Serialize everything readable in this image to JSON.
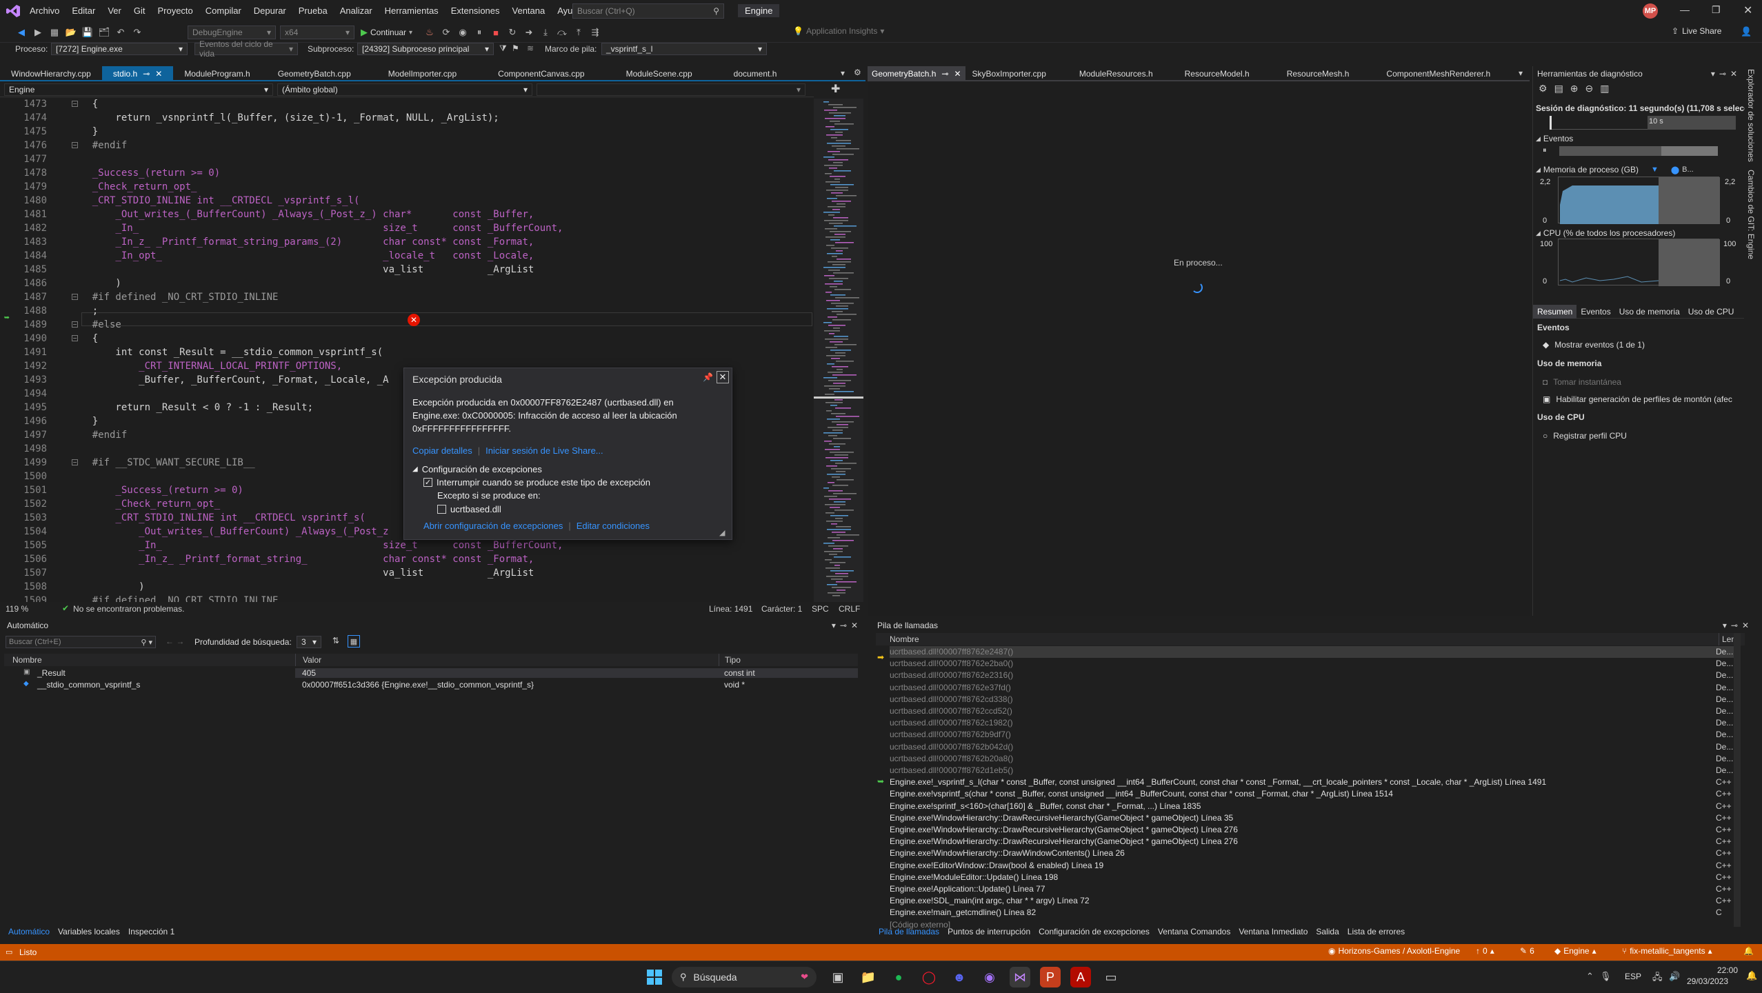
{
  "menubar": {
    "items": [
      "Archivo",
      "Editar",
      "Ver",
      "Git",
      "Proyecto",
      "Compilar",
      "Depurar",
      "Prueba",
      "Analizar",
      "Herramientas",
      "Extensiones",
      "Ventana",
      "Ayuda"
    ],
    "search_placeholder": "Buscar (Ctrl+Q)",
    "solution_name": "Engine",
    "user_initials": "MP"
  },
  "toolbar": {
    "config": "DebugEngine",
    "platform": "x64",
    "continue_label": "Continuar",
    "app_insights": "Application Insights",
    "live_share": "Live Share"
  },
  "toolbar2": {
    "process_label": "Proceso:",
    "process_value": "[7272] Engine.exe",
    "lifecycle_label": "Eventos del ciclo de vida",
    "thread_label": "Subproceso:",
    "thread_value": "[24392] Subproceso principal",
    "stack_frame_label": "Marco de pila:",
    "stack_frame_value": "_vsprintf_s_l"
  },
  "left_tabs": [
    "WindowHierarchy.cpp",
    "stdio.h",
    "ModuleProgram.h",
    "GeometryBatch.cpp",
    "ModelImporter.cpp",
    "ComponentCanvas.cpp",
    "ModuleScene.cpp",
    "document.h"
  ],
  "right_tabs": [
    "GeometryBatch.h",
    "SkyBoxImporter.cpp",
    "ModuleResources.h",
    "ResourceModel.h",
    "ResourceMesh.h",
    "ComponentMeshRenderer.h"
  ],
  "nav": {
    "project": "Engine",
    "scope": "(Ámbito global)"
  },
  "editor_status": {
    "zoom": "119 %",
    "issues": "No se encontraron problemas.",
    "line": "Línea: 1491",
    "char": "Carácter: 1",
    "spc": "SPC",
    "eol": "CRLF"
  },
  "code_lines": [
    {
      "n": "1473",
      "t": "    {"
    },
    {
      "n": "1474",
      "t": "        return _vsnprintf_l(_Buffer, (size_t)-1, _Format, NULL, _ArgList);"
    },
    {
      "n": "1475",
      "t": "    }"
    },
    {
      "n": "1476",
      "t": "    #endif"
    },
    {
      "n": "1477",
      "t": ""
    },
    {
      "n": "1478",
      "t": "    _Success_(return >= 0)"
    },
    {
      "n": "1479",
      "t": "    _Check_return_opt_"
    },
    {
      "n": "1480",
      "t": "    _CRT_STDIO_INLINE int __CRTDECL _vsprintf_s_l("
    },
    {
      "n": "1481",
      "t": "        _Out_writes_(_BufferCount) _Always_(_Post_z_) char*       const _Buffer,"
    },
    {
      "n": "1482",
      "t": "        _In_                                          size_t      const _BufferCount,"
    },
    {
      "n": "1483",
      "t": "        _In_z_ _Printf_format_string_params_(2)       char const* const _Format,"
    },
    {
      "n": "1484",
      "t": "        _In_opt_                                      _locale_t   const _Locale,"
    },
    {
      "n": "1485",
      "t": "                                                      va_list           _ArgList"
    },
    {
      "n": "1486",
      "t": "        )"
    },
    {
      "n": "1487",
      "t": "    #if defined _NO_CRT_STDIO_INLINE"
    },
    {
      "n": "1488",
      "t": "    ;"
    },
    {
      "n": "1489",
      "t": "    #else"
    },
    {
      "n": "1490",
      "t": "    {"
    },
    {
      "n": "1491",
      "t": "        int const _Result = __stdio_common_vsprintf_s("
    },
    {
      "n": "1492",
      "t": "            _CRT_INTERNAL_LOCAL_PRINTF_OPTIONS,"
    },
    {
      "n": "1493",
      "t": "            _Buffer, _BufferCount, _Format, _Locale, _A"
    },
    {
      "n": "1494",
      "t": ""
    },
    {
      "n": "1495",
      "t": "        return _Result < 0 ? -1 : _Result;"
    },
    {
      "n": "1496",
      "t": "    }"
    },
    {
      "n": "1497",
      "t": "    #endif"
    },
    {
      "n": "1498",
      "t": ""
    },
    {
      "n": "1499",
      "t": "    #if __STDC_WANT_SECURE_LIB__"
    },
    {
      "n": "1500",
      "t": ""
    },
    {
      "n": "1501",
      "t": "        _Success_(return >= 0)"
    },
    {
      "n": "1502",
      "t": "        _Check_return_opt_"
    },
    {
      "n": "1503",
      "t": "        _CRT_STDIO_INLINE int __CRTDECL vsprintf_s("
    },
    {
      "n": "1504",
      "t": "            _Out_writes_(_BufferCount) _Always_(_Post_z"
    },
    {
      "n": "1505",
      "t": "            _In_                                      size_t      const _BufferCount,"
    },
    {
      "n": "1506",
      "t": "            _In_z_ _Printf_format_string_             char const* const _Format,"
    },
    {
      "n": "1507",
      "t": "                                                      va_list           _ArgList"
    },
    {
      "n": "1508",
      "t": "            )"
    },
    {
      "n": "1509",
      "t": "    #if defined _NO_CRT_STDIO_INLINE"
    }
  ],
  "exception_popup": {
    "title": "Excepción producida",
    "message": "Excepción producida en 0x00007FF8762E2487 (ucrtbased.dll) en Engine.exe: 0xC0000005: Infracción de acceso al leer la ubicación 0xFFFFFFFFFFFFFFFF.",
    "copy_details": "Copiar detalles",
    "live_share": "Iniciar sesión de Live Share...",
    "config_header": "Configuración de excepciones",
    "break_label": "Interrumpir cuando se produce este tipo de excepción",
    "except_label": "Excepto si se produce en:",
    "dll_label": "ucrtbased.dll",
    "open_config": "Abrir configuración de excepciones",
    "edit_conditions": "Editar condiciones"
  },
  "doc_right": {
    "loading": "En proceso..."
  },
  "diagnostics": {
    "title": "Herramientas de diagnóstico",
    "session": "Sesión de diagnóstico: 11 segundo(s) (11,708 s selecc...",
    "timeline_label": "10 s",
    "events_header": "Eventos",
    "memory_header": "Memoria de proceso (GB)",
    "memory_legend": "B...",
    "mem_max": "2,2",
    "mem_min": "0",
    "cpu_header": "CPU (% de todos los procesadores)",
    "cpu_max": "100",
    "cpu_min": "0",
    "tabs": [
      "Resumen",
      "Eventos",
      "Uso de memoria",
      "Uso de CPU"
    ],
    "sec_events": "Eventos",
    "show_events": "Mostrar eventos (1 de 1)",
    "sec_memory": "Uso de memoria",
    "snapshot": "Tomar instantánea",
    "heap_profiling": "Habilitar generación de perfiles de montón (afec",
    "sec_cpu": "Uso de CPU",
    "record_cpu": "Registrar perfil CPU",
    "side_labels": [
      "Explorador de soluciones",
      "Cambios de GIT: Engine"
    ]
  },
  "autos": {
    "title": "Automático",
    "search_placeholder": "Buscar (Ctrl+E)",
    "depth_label": "Profundidad de búsqueda:",
    "depth_value": "3",
    "columns": [
      "Nombre",
      "Valor",
      "Tipo"
    ],
    "rows": [
      {
        "name": "_Result",
        "value": "405",
        "type": "const int"
      },
      {
        "name": "__stdio_common_vsprintf_s",
        "value": "0x00007ff651c3d366 {Engine.exe!__stdio_common_vsprintf_s}",
        "type": "void *"
      }
    ],
    "bottom_tabs": [
      "Automático",
      "Variables locales",
      "Inspección 1"
    ]
  },
  "callstack": {
    "title": "Pila de llamadas",
    "columns": [
      "Nombre",
      "Leng"
    ],
    "rows": [
      {
        "name": "ucrtbased.dll!00007ff8762e2487()",
        "lang": "De..."
      },
      {
        "name": "ucrtbased.dll!00007ff8762e2ba0()",
        "lang": "De..."
      },
      {
        "name": "ucrtbased.dll!00007ff8762e2316()",
        "lang": "De..."
      },
      {
        "name": "ucrtbased.dll!00007ff8762e37fd()",
        "lang": "De..."
      },
      {
        "name": "ucrtbased.dll!00007ff8762cd338()",
        "lang": "De..."
      },
      {
        "name": "ucrtbased.dll!00007ff8762ccd52()",
        "lang": "De..."
      },
      {
        "name": "ucrtbased.dll!00007ff8762c1982()",
        "lang": "De..."
      },
      {
        "name": "ucrtbased.dll!00007ff8762b9df7()",
        "lang": "De..."
      },
      {
        "name": "ucrtbased.dll!00007ff8762b042d()",
        "lang": "De..."
      },
      {
        "name": "ucrtbased.dll!00007ff8762b20a8()",
        "lang": "De..."
      },
      {
        "name": "ucrtbased.dll!00007ff8762d1eb5()",
        "lang": "De..."
      },
      {
        "name": "Engine.exe!_vsprintf_s_l(char * const _Buffer, const unsigned __int64 _BufferCount, const char * const _Format, __crt_locale_pointers * const _Locale, char * _ArgList) Línea 1491",
        "lang": "C++"
      },
      {
        "name": "Engine.exe!vsprintf_s(char * const _Buffer, const unsigned __int64 _BufferCount, const char * const _Format, char * _ArgList) Línea 1514",
        "lang": "C++"
      },
      {
        "name": "Engine.exe!sprintf_s<160>(char[160] & _Buffer, const char * _Format, ...) Línea 1835",
        "lang": "C++"
      },
      {
        "name": "Engine.exe!WindowHierarchy::DrawRecursiveHierarchy(GameObject * gameObject) Línea 35",
        "lang": "C++"
      },
      {
        "name": "Engine.exe!WindowHierarchy::DrawRecursiveHierarchy(GameObject * gameObject) Línea 276",
        "lang": "C++"
      },
      {
        "name": "Engine.exe!WindowHierarchy::DrawRecursiveHierarchy(GameObject * gameObject) Línea 276",
        "lang": "C++"
      },
      {
        "name": "Engine.exe!WindowHierarchy::DrawWindowContents() Línea 26",
        "lang": "C++"
      },
      {
        "name": "Engine.exe!EditorWindow::Draw(bool & enabled) Línea 19",
        "lang": "C++"
      },
      {
        "name": "Engine.exe!ModuleEditor::Update() Línea 198",
        "lang": "C++"
      },
      {
        "name": "Engine.exe!Application::Update() Línea 77",
        "lang": "C++"
      },
      {
        "name": "Engine.exe!SDL_main(int argc, char * * argv) Línea 72",
        "lang": "C++"
      },
      {
        "name": "Engine.exe!main_getcmdline() Línea 82",
        "lang": "C"
      },
      {
        "name": "[Código externo]",
        "lang": ""
      }
    ],
    "bottom_tabs": [
      "Pila de llamadas",
      "Puntos de interrupción",
      "Configuración de excepciones",
      "Ventana Comandos",
      "Ventana Inmediato",
      "Salida",
      "Lista de errores"
    ]
  },
  "statusbar": {
    "ready": "Listo",
    "repo": "Horizons-Games / Axolotl-Engine",
    "up_count": "0",
    "pencil_count": "6",
    "project": "Engine",
    "branch": "fix-metallic_tangents"
  },
  "taskbar": {
    "search_label": "Búsqueda",
    "lang": "ESP",
    "time": "22:00",
    "date": "29/03/2023"
  },
  "colors": {
    "accent": "#0e639c",
    "status": "#ca5100",
    "error": "#e51400",
    "link": "#3794ff"
  }
}
